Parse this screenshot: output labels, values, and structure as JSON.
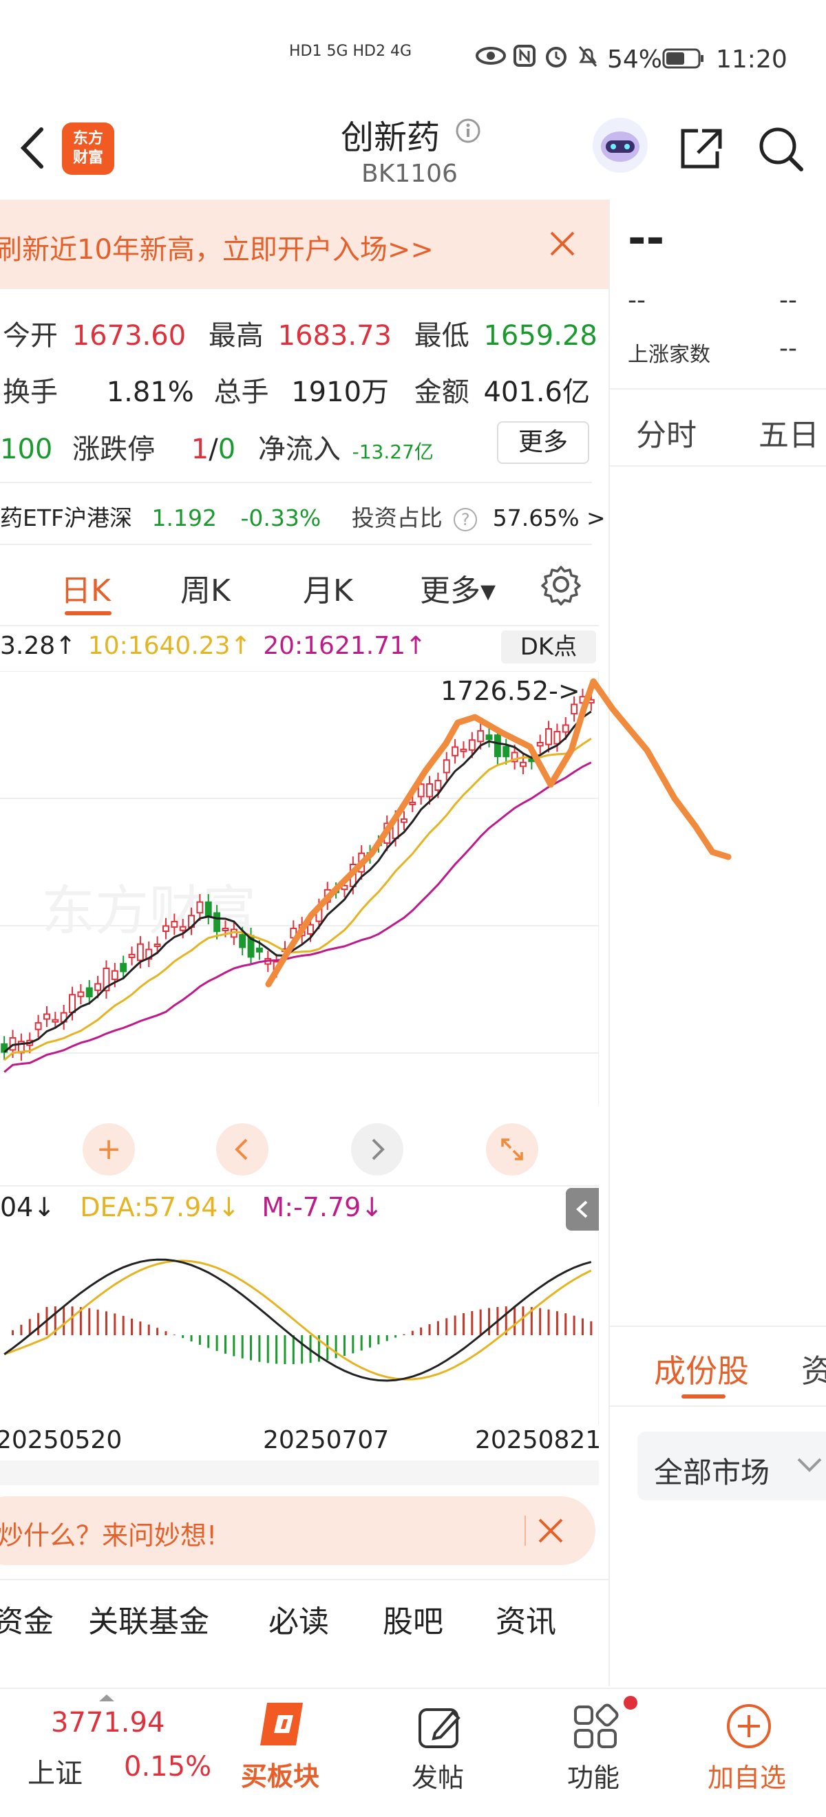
{
  "status_bar": {
    "network": "HD1 5G HD2 4G",
    "battery": "54%",
    "time": "11:20"
  },
  "header": {
    "title": "创新药",
    "code": "BK1106",
    "logo_line1": "东方",
    "logo_line2": "财富"
  },
  "banner": {
    "text": "刷新近10年新高，立即开户入场>>"
  },
  "quote": {
    "open_label": "今开",
    "open_value": "1673.60",
    "high_label": "最高",
    "high_value": "1683.73",
    "low_label": "最低",
    "low_value": "1659.28",
    "turnover_label": "换手",
    "turnover_value": "1.81%",
    "volume_label": "总手",
    "volume_value": "1910万",
    "amount_label": "金额",
    "amount_value": "401.6亿",
    "updown_count": "100",
    "limit_label": "涨跌停",
    "limit_up": "1",
    "limit_sep": "/",
    "limit_down": "0",
    "netflow_label": "净流入",
    "netflow_value": "-13.27亿",
    "more_label": "更多"
  },
  "etf": {
    "name": "药ETF沪港深",
    "price": "1.192",
    "change": "-0.33%",
    "ratio_label": "投资占比",
    "ratio_value": "57.65% >"
  },
  "tabs": {
    "items": [
      {
        "label": "日K"
      },
      {
        "label": "周K"
      },
      {
        "label": "月K"
      },
      {
        "label": "更多▾"
      }
    ]
  },
  "ma": {
    "ma5": "3.28↑",
    "ma10": "10:1640.23↑",
    "ma20": "20:1621.71↑",
    "dk_label": "DK点"
  },
  "kline": {
    "peak_label": "1726.52->",
    "watermark": "东方财富"
  },
  "macd": {
    "diff": "04↓",
    "dea": "DEA:57.94↓",
    "m": "M:-7.79↓"
  },
  "dates": [
    "20250520",
    "20250707",
    "20250821"
  ],
  "ask_bar": {
    "text": "炒什么？来问妙想!"
  },
  "bottom_tabs": [
    "资金",
    "关联基金",
    "必读",
    "股吧",
    "资讯"
  ],
  "side_panel": {
    "big_dash": "--",
    "row1_left": "--",
    "row1_right": "--",
    "up_label": "上涨家数",
    "up_value": "--",
    "tab_fenshi": "分时",
    "tab_wuri": "五日",
    "tab_components": "成份股",
    "tab_zi": "资",
    "market_select": "全部市场"
  },
  "bottom_nav": {
    "index_value": "3771.94",
    "index_name": "上证",
    "index_change": "0.15%",
    "buy_sector": "买板块",
    "post": "发帖",
    "function": "功能",
    "add_watch": "加自选"
  },
  "colors": {
    "accent": "#e5602a",
    "up": "#e0303b",
    "down": "#1a9a2e",
    "ma10": "#e6b422",
    "ma20": "#c01a8a",
    "annotation": "#f08a3c"
  },
  "chart_data": {
    "type": "candlestick",
    "x": [
      "20250520",
      "20250707",
      "20250821"
    ],
    "peak": 1726.52,
    "series": [
      {
        "name": "10",
        "last": 1640.23
      },
      {
        "name": "20",
        "last": 1621.71
      }
    ],
    "indicator": {
      "DEA": 57.94,
      "M": -7.79
    }
  }
}
